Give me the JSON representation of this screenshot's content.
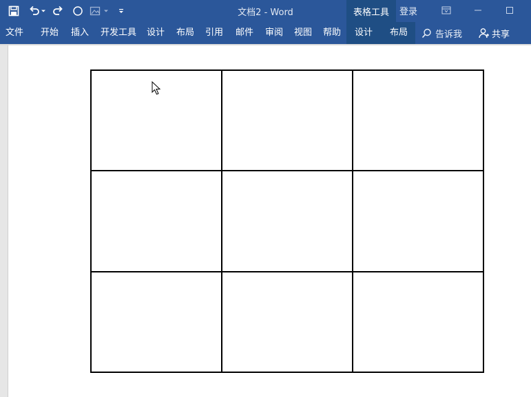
{
  "app": {
    "title": "文档2  -  Word",
    "context_tab_group": "表格工具",
    "login_label": "登录"
  },
  "menu": {
    "items": [
      "文件",
      "开始",
      "插入",
      "开发工具",
      "设计",
      "布局",
      "引用",
      "邮件",
      "审阅",
      "视图",
      "帮助"
    ],
    "context_items": [
      "设计",
      "布局"
    ],
    "tell_me": "告诉我",
    "share": "共享"
  },
  "icons": [
    "save-icon",
    "undo-icon",
    "redo-icon",
    "circle-icon",
    "image-icon",
    "customize-qat-icon",
    "ribbon-display-icon",
    "minimize-icon",
    "maximize-icon",
    "lightbulb-search-icon",
    "person-add-icon",
    "mouse-cursor-icon"
  ],
  "table": {
    "rows": 3,
    "cols": 3,
    "cells": [
      [
        "",
        "",
        ""
      ],
      [
        "",
        "",
        ""
      ],
      [
        "",
        "",
        ""
      ]
    ]
  },
  "colors": {
    "ribbon": "#2b579a",
    "context_tab": "#1f4e84"
  }
}
